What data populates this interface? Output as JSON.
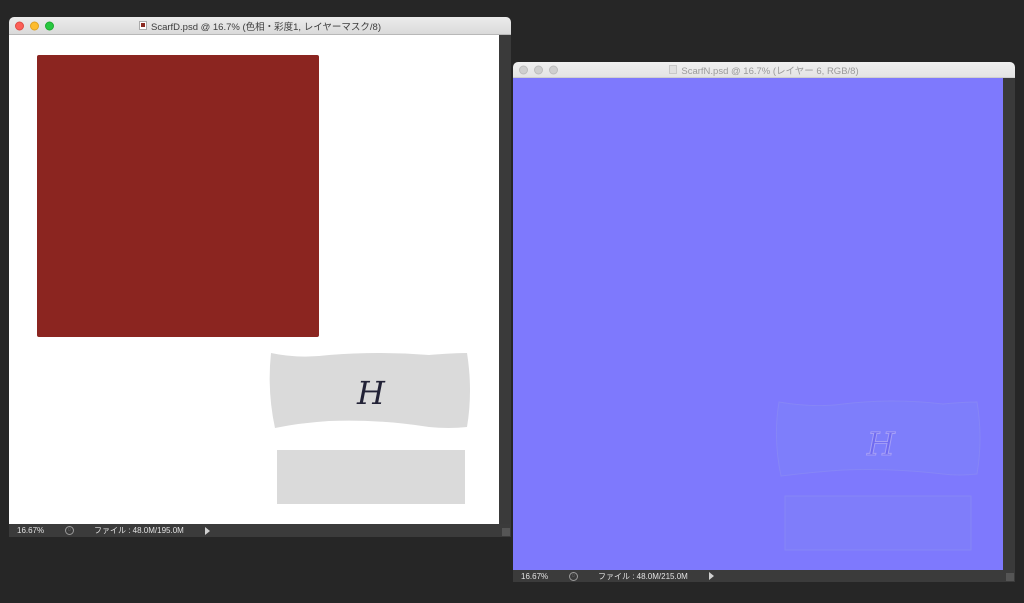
{
  "windows": [
    {
      "title": "ScarfD.psd @ 16.7% (色相・彩度1, レイヤーマスク/8)",
      "zoom": "16.67%",
      "file_info": "ファイル : 48.0M/195.0M",
      "logo_text": "H"
    },
    {
      "title": "ScarfN.psd @ 16.7% (レイヤー 6, RGB/8)",
      "zoom": "16.67%",
      "file_info": "ファイル : 48.0M/215.0M",
      "logo_text": "H"
    }
  ],
  "colors": {
    "desktop": "#262626",
    "scarf_red": "#8b2520",
    "normal_map_blue": "#7e79fd",
    "mask_grey": "#dadada"
  }
}
